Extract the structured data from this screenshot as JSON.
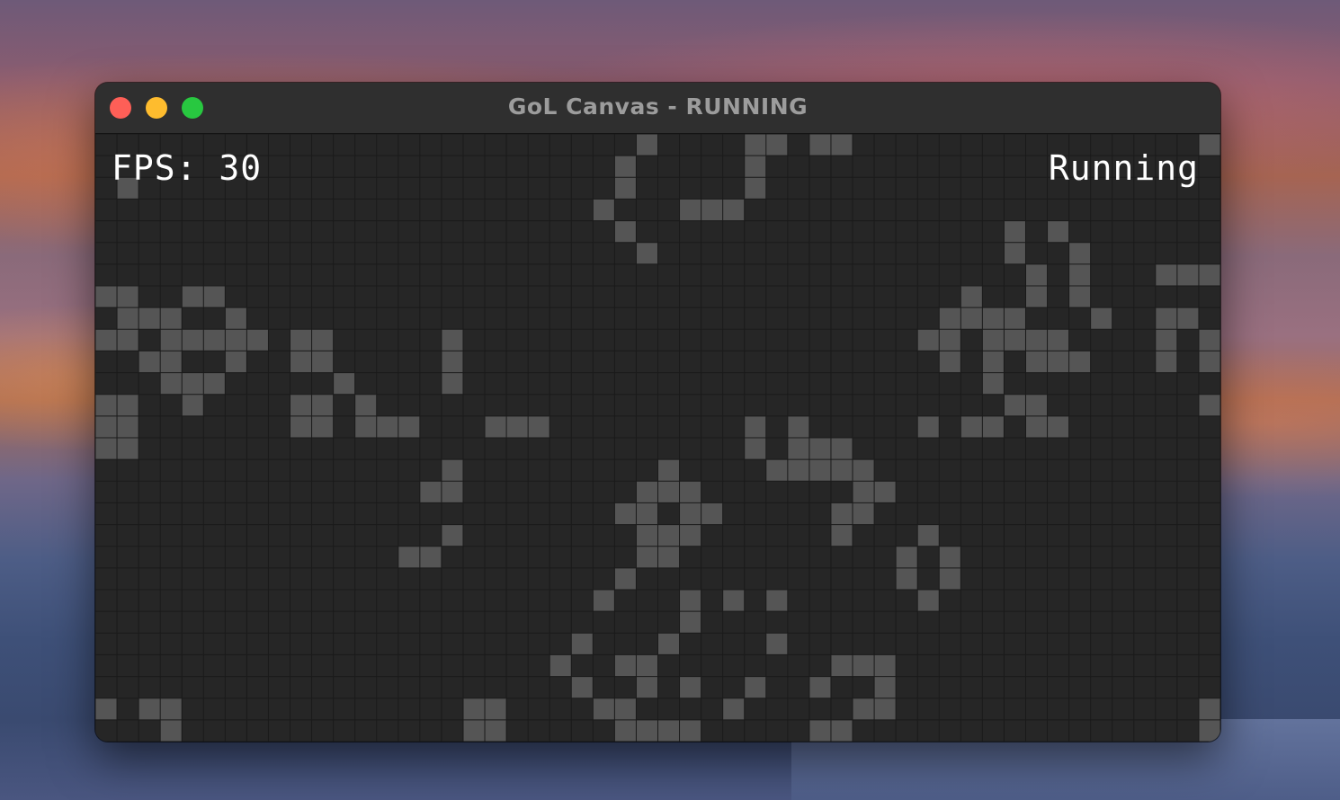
{
  "window": {
    "title": "GoL Canvas - RUNNING"
  },
  "hud": {
    "fps": "FPS: 30",
    "status": "Running"
  },
  "grid": {
    "columns": 52,
    "rows": 28,
    "alive_color": "#555555",
    "dead_color": "#262626",
    "grid_line_color": "#1a1a1a",
    "alive_cells": [
      [
        25,
        0
      ],
      [
        30,
        0
      ],
      [
        31,
        0
      ],
      [
        33,
        0
      ],
      [
        34,
        0
      ],
      [
        51,
        0
      ],
      [
        24,
        1
      ],
      [
        30,
        1
      ],
      [
        1,
        2
      ],
      [
        24,
        2
      ],
      [
        30,
        2
      ],
      [
        23,
        3
      ],
      [
        27,
        3
      ],
      [
        28,
        3
      ],
      [
        29,
        3
      ],
      [
        24,
        4
      ],
      [
        42,
        4
      ],
      [
        44,
        4
      ],
      [
        25,
        5
      ],
      [
        42,
        5
      ],
      [
        45,
        5
      ],
      [
        43,
        6
      ],
      [
        45,
        6
      ],
      [
        49,
        6
      ],
      [
        50,
        6
      ],
      [
        51,
        6
      ],
      [
        0,
        7
      ],
      [
        1,
        7
      ],
      [
        4,
        7
      ],
      [
        5,
        7
      ],
      [
        40,
        7
      ],
      [
        43,
        7
      ],
      [
        45,
        7
      ],
      [
        1,
        8
      ],
      [
        2,
        8
      ],
      [
        3,
        8
      ],
      [
        6,
        8
      ],
      [
        39,
        8
      ],
      [
        40,
        8
      ],
      [
        41,
        8
      ],
      [
        42,
        8
      ],
      [
        46,
        8
      ],
      [
        49,
        8
      ],
      [
        50,
        8
      ],
      [
        0,
        9
      ],
      [
        1,
        9
      ],
      [
        3,
        9
      ],
      [
        4,
        9
      ],
      [
        5,
        9
      ],
      [
        6,
        9
      ],
      [
        7,
        9
      ],
      [
        9,
        9
      ],
      [
        10,
        9
      ],
      [
        16,
        9
      ],
      [
        38,
        9
      ],
      [
        39,
        9
      ],
      [
        41,
        9
      ],
      [
        42,
        9
      ],
      [
        43,
        9
      ],
      [
        44,
        9
      ],
      [
        49,
        9
      ],
      [
        51,
        9
      ],
      [
        2,
        10
      ],
      [
        3,
        10
      ],
      [
        6,
        10
      ],
      [
        9,
        10
      ],
      [
        10,
        10
      ],
      [
        16,
        10
      ],
      [
        39,
        10
      ],
      [
        41,
        10
      ],
      [
        43,
        10
      ],
      [
        44,
        10
      ],
      [
        45,
        10
      ],
      [
        49,
        10
      ],
      [
        51,
        10
      ],
      [
        3,
        11
      ],
      [
        4,
        11
      ],
      [
        5,
        11
      ],
      [
        11,
        11
      ],
      [
        16,
        11
      ],
      [
        41,
        11
      ],
      [
        0,
        12
      ],
      [
        1,
        12
      ],
      [
        4,
        12
      ],
      [
        9,
        12
      ],
      [
        10,
        12
      ],
      [
        12,
        12
      ],
      [
        42,
        12
      ],
      [
        43,
        12
      ],
      [
        51,
        12
      ],
      [
        0,
        13
      ],
      [
        1,
        13
      ],
      [
        9,
        13
      ],
      [
        10,
        13
      ],
      [
        12,
        13
      ],
      [
        13,
        13
      ],
      [
        14,
        13
      ],
      [
        18,
        13
      ],
      [
        19,
        13
      ],
      [
        20,
        13
      ],
      [
        30,
        13
      ],
      [
        32,
        13
      ],
      [
        38,
        13
      ],
      [
        40,
        13
      ],
      [
        41,
        13
      ],
      [
        43,
        13
      ],
      [
        44,
        13
      ],
      [
        0,
        14
      ],
      [
        1,
        14
      ],
      [
        30,
        14
      ],
      [
        32,
        14
      ],
      [
        33,
        14
      ],
      [
        34,
        14
      ],
      [
        16,
        15
      ],
      [
        26,
        15
      ],
      [
        31,
        15
      ],
      [
        32,
        15
      ],
      [
        33,
        15
      ],
      [
        34,
        15
      ],
      [
        35,
        15
      ],
      [
        15,
        16
      ],
      [
        16,
        16
      ],
      [
        25,
        16
      ],
      [
        26,
        16
      ],
      [
        27,
        16
      ],
      [
        35,
        16
      ],
      [
        36,
        16
      ],
      [
        24,
        17
      ],
      [
        25,
        17
      ],
      [
        27,
        17
      ],
      [
        28,
        17
      ],
      [
        34,
        17
      ],
      [
        35,
        17
      ],
      [
        16,
        18
      ],
      [
        25,
        18
      ],
      [
        26,
        18
      ],
      [
        27,
        18
      ],
      [
        34,
        18
      ],
      [
        38,
        18
      ],
      [
        14,
        19
      ],
      [
        15,
        19
      ],
      [
        25,
        19
      ],
      [
        26,
        19
      ],
      [
        37,
        19
      ],
      [
        39,
        19
      ],
      [
        24,
        20
      ],
      [
        37,
        20
      ],
      [
        39,
        20
      ],
      [
        23,
        21
      ],
      [
        27,
        21
      ],
      [
        29,
        21
      ],
      [
        31,
        21
      ],
      [
        38,
        21
      ],
      [
        27,
        22
      ],
      [
        22,
        23
      ],
      [
        26,
        23
      ],
      [
        31,
        23
      ],
      [
        21,
        24
      ],
      [
        24,
        24
      ],
      [
        25,
        24
      ],
      [
        34,
        24
      ],
      [
        35,
        24
      ],
      [
        36,
        24
      ],
      [
        22,
        25
      ],
      [
        25,
        25
      ],
      [
        27,
        25
      ],
      [
        30,
        25
      ],
      [
        33,
        25
      ],
      [
        36,
        25
      ],
      [
        0,
        26
      ],
      [
        2,
        26
      ],
      [
        3,
        26
      ],
      [
        17,
        26
      ],
      [
        18,
        26
      ],
      [
        23,
        26
      ],
      [
        24,
        26
      ],
      [
        29,
        26
      ],
      [
        35,
        26
      ],
      [
        36,
        26
      ],
      [
        51,
        26
      ],
      [
        3,
        27
      ],
      [
        17,
        27
      ],
      [
        18,
        27
      ],
      [
        24,
        27
      ],
      [
        25,
        27
      ],
      [
        26,
        27
      ],
      [
        27,
        27
      ],
      [
        33,
        27
      ],
      [
        34,
        27
      ],
      [
        51,
        27
      ]
    ]
  }
}
